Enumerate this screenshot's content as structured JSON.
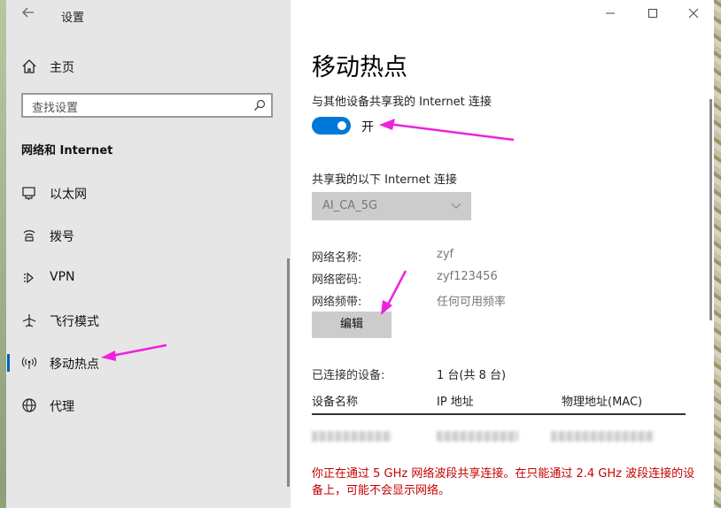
{
  "window": {
    "title": "设置",
    "controls": {
      "minimize_icon": "minimize-icon",
      "maximize_icon": "maximize-icon",
      "close_icon": "close-icon"
    }
  },
  "sidebar": {
    "home": {
      "label": "主页",
      "icon": "home-icon"
    },
    "search": {
      "placeholder": "查找设置",
      "icon": "search-icon"
    },
    "section_title": "网络和 Internet",
    "items": [
      {
        "label": "以太网",
        "icon": "ethernet-icon"
      },
      {
        "label": "拨号",
        "icon": "dialup-icon"
      },
      {
        "label": "VPN",
        "icon": "vpn-icon"
      },
      {
        "label": "飞行模式",
        "icon": "airplane-icon"
      },
      {
        "label": "移动热点",
        "icon": "hotspot-icon",
        "selected": true
      },
      {
        "label": "代理",
        "icon": "proxy-icon"
      }
    ]
  },
  "main": {
    "title": "移动热点",
    "share_label": "与其他设备共享我的 Internet 连接",
    "toggle": {
      "on": true,
      "state_label": "开"
    },
    "share_from_label": "共享我的以下 Internet 连接",
    "share_from_value": "AI_CA_5G",
    "network": {
      "name_label": "网络名称:",
      "name_value": "zyf",
      "password_label": "网络密码:",
      "password_value": "zyf123456",
      "band_label": "网络频带:",
      "band_value": "任何可用频率"
    },
    "edit_button": "编辑",
    "connected": {
      "label": "已连接的设备:",
      "value": "1 台(共 8 台)"
    },
    "table_headers": [
      "设备名称",
      "IP 地址",
      "物理地址(MAC)"
    ],
    "warning": "你正在通过 5 GHz 网络波段共享连接。在只能通过 2.4 GHz 波段连接的设备上，可能不会显示网络。"
  },
  "colors": {
    "accent": "#0078d7",
    "warning": "#c50000",
    "annotation": "#ee22dd"
  }
}
